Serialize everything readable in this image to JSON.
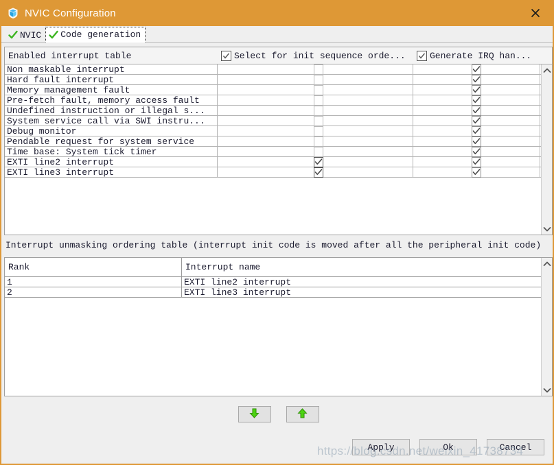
{
  "window": {
    "title": "NVIC Configuration",
    "icon": "cube-icon",
    "close_label": "✕",
    "accent_color": "#DE9836",
    "titlebar_text_color": "#FFFFFF"
  },
  "tabs": [
    {
      "label": "NVIC",
      "icon": "green-check-icon",
      "active": false
    },
    {
      "label": "Code generation",
      "icon": "green-check-icon",
      "active": true
    }
  ],
  "interrupt_table": {
    "columns": [
      {
        "label": "Enabled interrupt table",
        "has_checkbox": false
      },
      {
        "label": "Select for init sequence orde...",
        "has_checkbox": true,
        "checked": true
      },
      {
        "label": "Generate IRQ han...",
        "has_checkbox": true,
        "checked": true
      }
    ],
    "rows": [
      {
        "name": "Non maskable interrupt",
        "select_init": false,
        "generate_irq": true
      },
      {
        "name": "Hard fault interrupt",
        "select_init": false,
        "generate_irq": true
      },
      {
        "name": "Memory management fault",
        "select_init": false,
        "generate_irq": true
      },
      {
        "name": "Pre-fetch fault, memory access fault",
        "select_init": false,
        "generate_irq": true
      },
      {
        "name": "Undefined instruction or illegal s...",
        "select_init": false,
        "generate_irq": true
      },
      {
        "name": "System service call via SWI instru...",
        "select_init": false,
        "generate_irq": true
      },
      {
        "name": "Debug monitor",
        "select_init": false,
        "generate_irq": true
      },
      {
        "name": "Pendable request for system service",
        "select_init": false,
        "generate_irq": true
      },
      {
        "name": "Time base: System tick timer",
        "select_init": false,
        "generate_irq": true
      },
      {
        "name": "EXTI line2 interrupt",
        "select_init": true,
        "generate_irq": true
      },
      {
        "name": "EXTI line3 interrupt",
        "select_init": true,
        "generate_irq": true
      }
    ]
  },
  "ordering_section": {
    "title": "Interrupt unmasking ordering table (interrupt init code is moved after all the peripheral init code)",
    "columns": [
      "Rank",
      "Interrupt name"
    ],
    "rows": [
      {
        "rank": "1",
        "name": "EXTI line2 interrupt"
      },
      {
        "rank": "2",
        "name": "EXTI line3 interrupt"
      }
    ]
  },
  "move_buttons": [
    {
      "name": "move-down",
      "icon": "arrow-down-icon"
    },
    {
      "name": "move-up",
      "icon": "arrow-up-icon"
    }
  ],
  "footer": {
    "apply": "Apply",
    "ok": "Ok",
    "cancel": "Cancel"
  },
  "watermark": "https://blog.csdn.net/weixin_41738734"
}
